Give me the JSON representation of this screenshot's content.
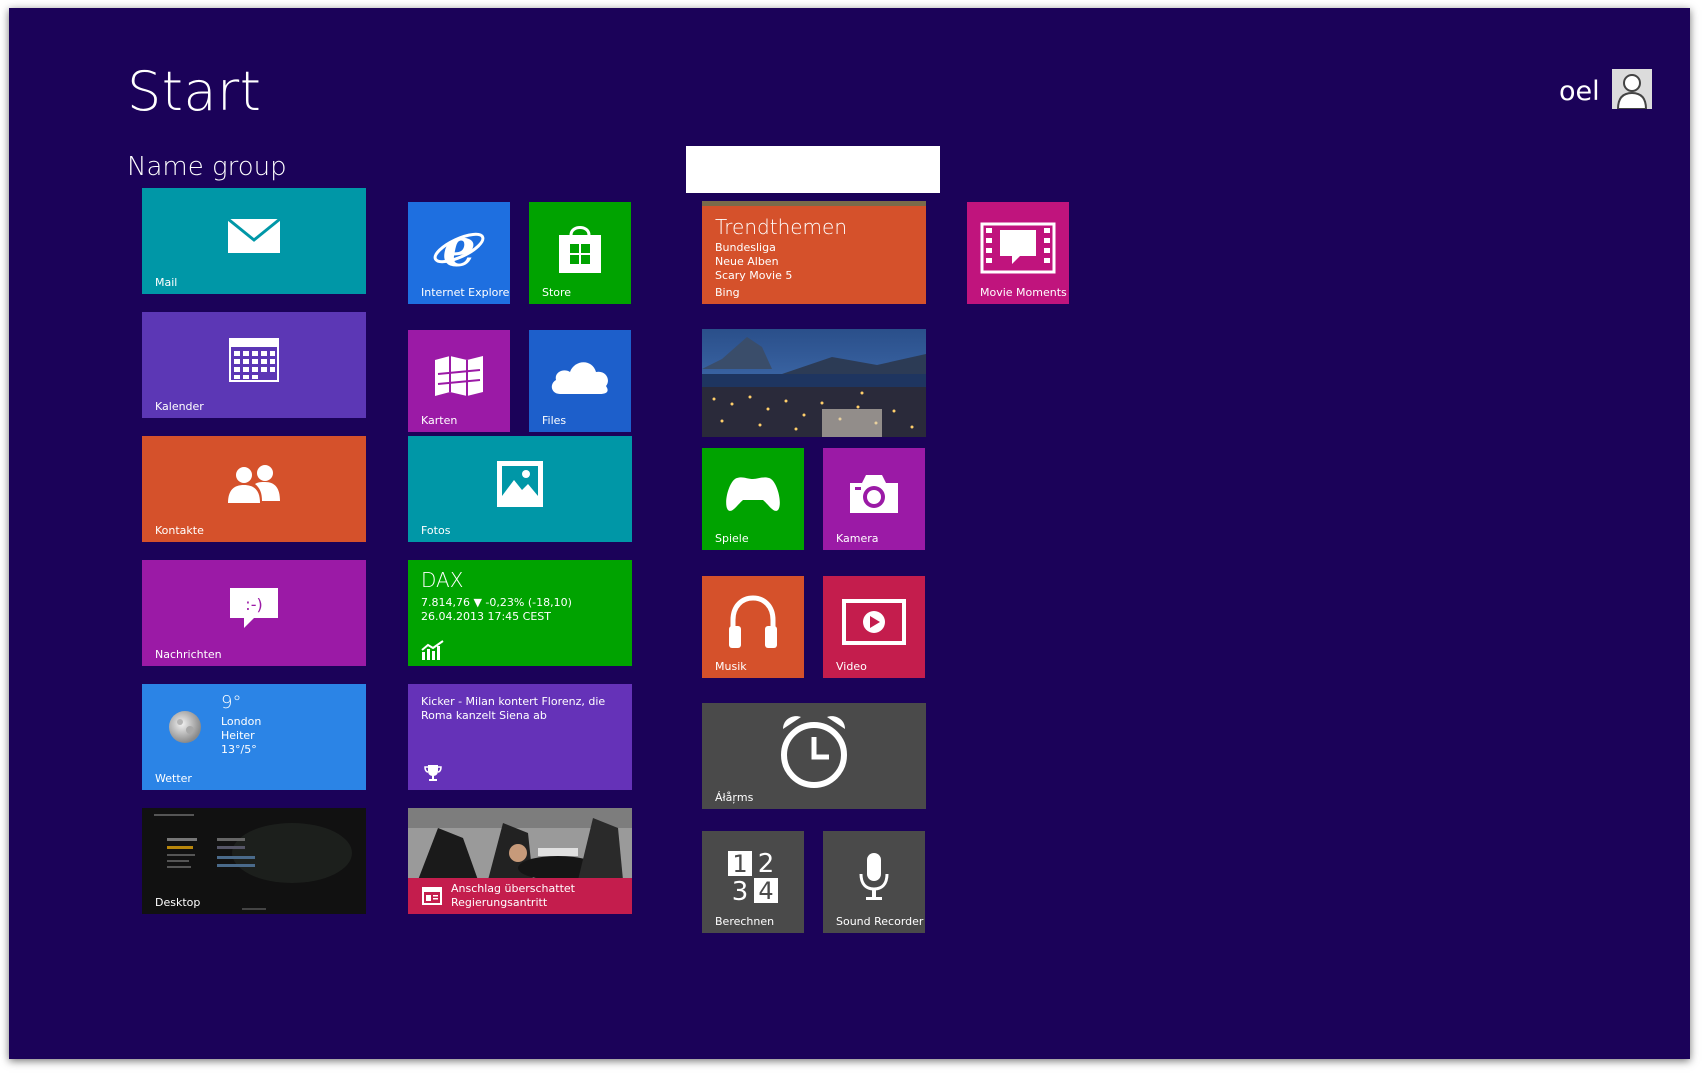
{
  "start": {
    "title": "Start",
    "group_name": "Name group",
    "user_name": "oel"
  },
  "tiles": {
    "mail": {
      "label": "Mail",
      "icon": "mail-icon",
      "color": "#0097a7"
    },
    "internet_explorer": {
      "label": "Internet Explorer",
      "icon": "ie-icon",
      "color": "#1e6fe0"
    },
    "store": {
      "label": "Store",
      "icon": "store-icon",
      "color": "#00a300"
    },
    "kalender": {
      "label": "Kalender",
      "icon": "calendar-icon",
      "color": "#5c37b5"
    },
    "karten": {
      "label": "Karten",
      "icon": "map-icon",
      "color": "#9b1aa6"
    },
    "files": {
      "label": "Files",
      "icon": "cloud-icon",
      "color": "#1d5fcb"
    },
    "kontakte": {
      "label": "Kontakte",
      "icon": "people-icon",
      "color": "#d5512b"
    },
    "fotos": {
      "label": "Fotos",
      "icon": "photo-icon",
      "color": "#0097a7"
    },
    "nachrichten": {
      "label": "Nachrichten",
      "icon": "message-icon",
      "color": "#9b1aa6"
    },
    "dax": {
      "title": "DAX",
      "line1": "7.814,76  ▼ -0,23% (-18,10)",
      "line2": "26.04.2013 17:45 CEST",
      "icon": "finance-icon",
      "color": "#00a300"
    },
    "wetter": {
      "label": "Wetter",
      "temp": "9°",
      "city": "London",
      "condition": "Heiter",
      "range": "13°/5°",
      "icon": "moon-icon",
      "color": "#2b84e6"
    },
    "sport": {
      "text": "Kicker - Milan kontert Florenz, die Roma kanzelt Siena ab",
      "icon": "trophy-icon",
      "color": "#6532b8"
    },
    "desktop": {
      "label": "Desktop",
      "color": "#0d0d0d"
    },
    "news": {
      "text": "Anschlag überschattet Regierungsantritt",
      "icon": "news-icon",
      "color": "#c41d4d"
    },
    "bing": {
      "title": "Trendthemen",
      "items": [
        "Bundesliga",
        "Neue Alben",
        "Scary Movie 5"
      ],
      "label": "Bing",
      "color": "#d5512b"
    },
    "movie_moments": {
      "label": "Movie Moments",
      "icon": "film-icon",
      "color": "#c0147d"
    },
    "spiele": {
      "label": "Spiele",
      "icon": "controller-icon",
      "color": "#00a300"
    },
    "kamera": {
      "label": "Kamera",
      "icon": "camera-icon",
      "color": "#9b1aa6"
    },
    "musik": {
      "label": "Musik",
      "icon": "headphones-icon",
      "color": "#d5512b"
    },
    "video": {
      "label": "Video",
      "icon": "play-icon",
      "color": "#c41d4d"
    },
    "alarms": {
      "label": "Áłåŗms",
      "icon": "alarm-clock-icon",
      "color": "#4a4a4a"
    },
    "berechnen": {
      "label": "Berechnen",
      "icon": "calculator-icon",
      "color": "#4a4a4a"
    },
    "sound_recorder": {
      "label": "Sound Recorder",
      "icon": "microphone-icon",
      "color": "#4a4a4a"
    }
  }
}
